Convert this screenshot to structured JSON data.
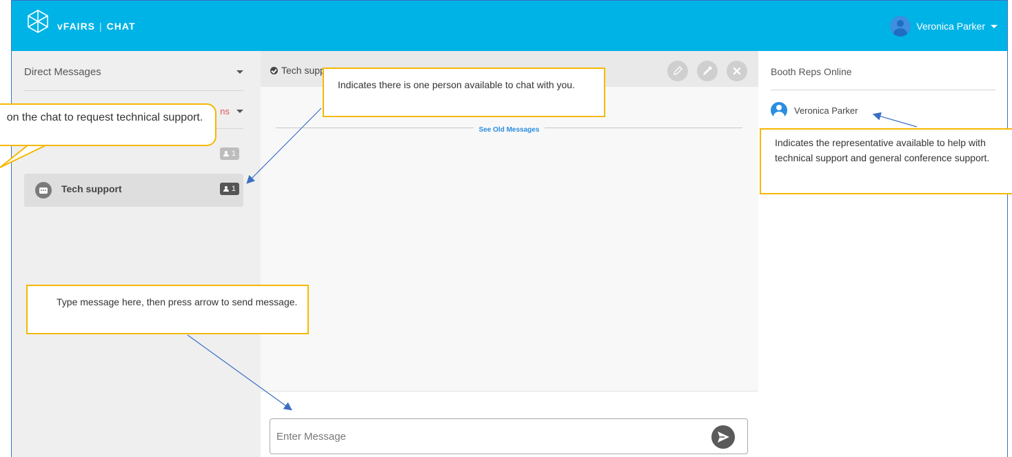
{
  "header": {
    "brand": "vFAIRS",
    "separator": "|",
    "section": "CHAT",
    "user_name": "Veronica Parker"
  },
  "sidebar": {
    "direct_messages_label": "Direct Messages",
    "rooms_label_fragment": "ns",
    "rooms": [
      {
        "name": "",
        "count": "1"
      },
      {
        "name": "Tech support",
        "count": "1"
      }
    ]
  },
  "chat": {
    "title": "Tech support",
    "see_old_messages": "See Old Messages",
    "input_placeholder": "Enter Message"
  },
  "reps": {
    "title": "Booth Reps Online",
    "rep_name": "Veronica Parker"
  },
  "annotations": {
    "top": "Indicates there is one person available to chat with you.",
    "right": "Indicates the representative available to help with technical support and general conference support.",
    "bottom": "Type message here, then press arrow to send message.",
    "left": "on the chat to request technical support."
  },
  "colors": {
    "topbar": "#00b3e6",
    "callout_border": "#f5b800",
    "arrow": "#3a6fc4",
    "link": "#2a8de0"
  }
}
